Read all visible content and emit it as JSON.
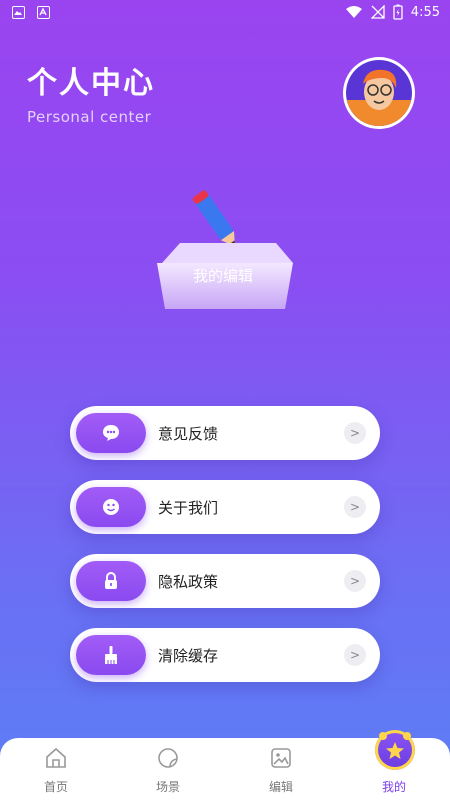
{
  "status_bar": {
    "time": "4:55"
  },
  "header": {
    "title": "个人中心",
    "subtitle": "Personal center"
  },
  "edit": {
    "label": "我的编辑"
  },
  "menu": [
    {
      "label": "意见反馈",
      "icon": "chat-bubble-icon"
    },
    {
      "label": "关于我们",
      "icon": "smiley-icon"
    },
    {
      "label": "隐私政策",
      "icon": "lock-icon"
    },
    {
      "label": "清除缓存",
      "icon": "brush-icon"
    }
  ],
  "tabs": [
    {
      "label": "首页",
      "icon": "home-icon"
    },
    {
      "label": "场景",
      "icon": "scene-icon"
    },
    {
      "label": "编辑",
      "icon": "image-edit-icon"
    },
    {
      "label": "我的",
      "icon": "star-profile-icon",
      "active": true
    }
  ],
  "colors": {
    "accent": "#8a4af0",
    "gradient_top": "#9a44f0",
    "gradient_bottom": "#5b80f5"
  }
}
